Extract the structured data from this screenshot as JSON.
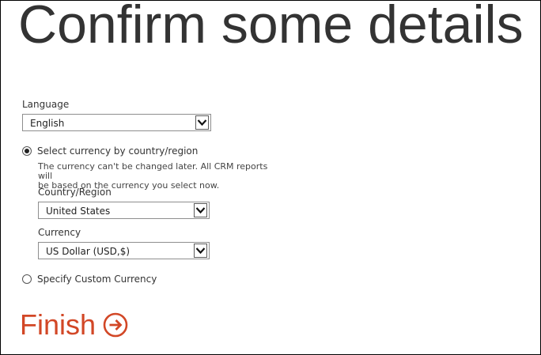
{
  "page": {
    "title": "Confirm some details"
  },
  "language": {
    "label": "Language",
    "value": "English"
  },
  "currency_by_country": {
    "radio_label": "Select currency by country/region",
    "selected": true,
    "note_line1": "The currency can't be changed later. All CRM reports will",
    "note_line2": "be based on the currency you select now.",
    "country_label": "Country/Region",
    "country_value": "United States",
    "currency_label": "Currency",
    "currency_value": "US Dollar (USD,$)"
  },
  "custom_currency": {
    "radio_label": "Specify Custom Currency",
    "selected": false
  },
  "finish": {
    "label": "Finish",
    "icon": "arrow-circle-right-icon"
  },
  "colors": {
    "accent": "#d24726",
    "text": "#333333"
  }
}
